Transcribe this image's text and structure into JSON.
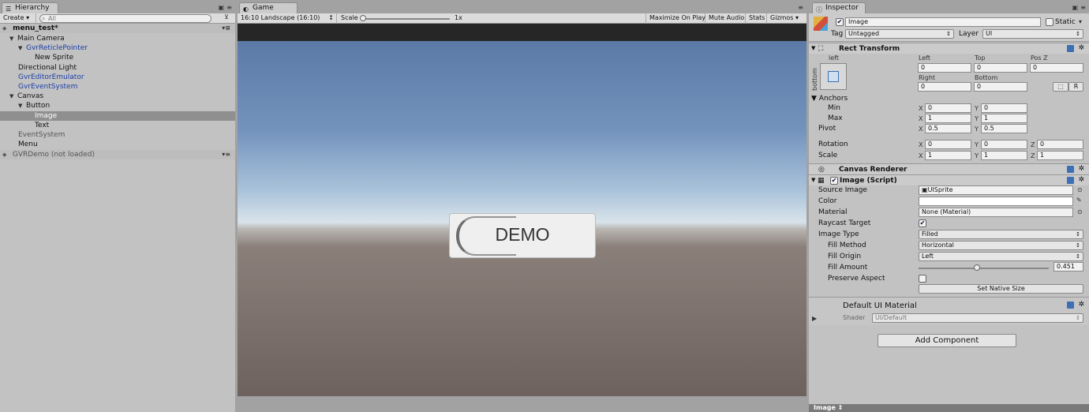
{
  "hierarchy": {
    "tab": "Hierarchy",
    "create": "Create",
    "search_placeholder": "All",
    "scene": "menu_test*",
    "items": [
      {
        "label": "Main Camera",
        "tri": "▼"
      },
      {
        "label": "GvrReticlePointer",
        "tri": "▼"
      },
      {
        "label": "New Sprite",
        "tri": ""
      },
      {
        "label": "Directional Light",
        "tri": ""
      },
      {
        "label": "GvrEditorEmulator",
        "tri": ""
      },
      {
        "label": "GvrEventSystem",
        "tri": ""
      },
      {
        "label": "Canvas",
        "tri": "▼"
      },
      {
        "label": "Button",
        "tri": "▼"
      },
      {
        "label": "Image",
        "tri": ""
      },
      {
        "label": "Text",
        "tri": ""
      },
      {
        "label": "EventSystem",
        "tri": ""
      },
      {
        "label": "Menu",
        "tri": ""
      }
    ],
    "scene2": "GVRDemo (not loaded)"
  },
  "game": {
    "tab": "Game",
    "aspect": "16:10 Landscape (16:10)",
    "scale_label": "Scale",
    "scale_value": "1x",
    "maximize": "Maximize On Play",
    "mute": "Mute Audio",
    "stats": "Stats",
    "gizmos": "Gizmos",
    "demo_text": "DEMO",
    "fill_amount": 0.451
  },
  "inspector": {
    "tab": "Inspector",
    "name": "Image",
    "static": "Static",
    "tag_label": "Tag",
    "tag": "Untagged",
    "layer_label": "Layer",
    "layer": "UI",
    "rect_transform": "Rect Transform",
    "left_label": "left",
    "bottom_label": "bottom",
    "col_left": "Left",
    "col_top": "Top",
    "col_posz": "Pos Z",
    "left": "0",
    "top": "0",
    "posz": "0",
    "col_right": "Right",
    "col_bottom": "Bottom",
    "right": "0",
    "bottom": "0",
    "r_btn": "R",
    "anchors": "Anchors",
    "min": "Min",
    "max": "Max",
    "min_x": "0",
    "min_y": "0",
    "max_x": "1",
    "max_y": "1",
    "pivot": "Pivot",
    "pivot_x": "0.5",
    "pivot_y": "0.5",
    "rotation": "Rotation",
    "rot_x": "0",
    "rot_y": "0",
    "rot_z": "0",
    "scale": "Scale",
    "scale_x": "1",
    "scale_y": "1",
    "scale_z": "1",
    "canvas_renderer": "Canvas Renderer",
    "image_script": "Image (Script)",
    "source_image_label": "Source Image",
    "source_image": "UISprite",
    "color_label": "Color",
    "material_label": "Material",
    "material": "None (Material)",
    "raycast_label": "Raycast Target",
    "image_type_label": "Image Type",
    "image_type": "Filled",
    "fill_method_label": "Fill Method",
    "fill_method": "Horizontal",
    "fill_origin_label": "Fill Origin",
    "fill_origin": "Left",
    "fill_amount_label": "Fill Amount",
    "fill_amount": "0.451",
    "preserve_label": "Preserve Aspect",
    "native_size": "Set Native Size",
    "default_mat": "Default UI Material",
    "shader_label": "Shader",
    "shader": "UI/Default",
    "add_component": "Add Component",
    "footer": "Image"
  },
  "colors": {
    "accent_blue": "#1b3ea8",
    "selection": "#8f8f8f"
  }
}
